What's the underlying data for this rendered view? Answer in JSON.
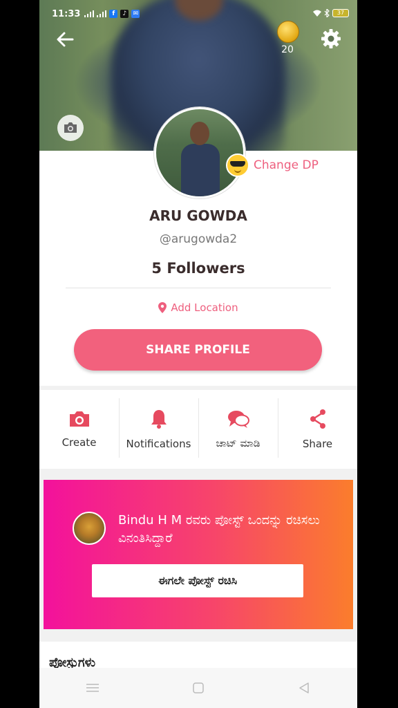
{
  "status_bar": {
    "time": "11:33",
    "battery": "37"
  },
  "header": {
    "coin_count": "20"
  },
  "profile": {
    "change_dp_label": "Change DP",
    "name": "ARU GOWDA",
    "handle": "@arugowda2",
    "followers": "5 Followers",
    "location_label": "Add Location",
    "share_profile_label": "SHARE PROFILE"
  },
  "actions": [
    {
      "label": "Create",
      "icon": "camera-icon"
    },
    {
      "label": "Notifications",
      "icon": "bell-icon"
    },
    {
      "label": "ಚಾಟ್ ಮಾಡಿ",
      "icon": "chat-icon"
    },
    {
      "label": "Share",
      "icon": "share-icon"
    }
  ],
  "promo": {
    "message": "Bindu H M ರವರು ಪೋಸ್ಟ್ ಒಂದನ್ನು ರಚಿಸಲು ವಿನಂತಿಸಿದ್ದಾರೆ",
    "button_label": "ಈಗಲೇ ಪೋಸ್ಟ್ ರಚಿಸಿ"
  },
  "section": {
    "title": "ಪೋಸ್ಟುಗಳು"
  },
  "colors": {
    "accent": "#f2617d",
    "promo_start": "#f3119c",
    "promo_end": "#fb7d2c"
  }
}
